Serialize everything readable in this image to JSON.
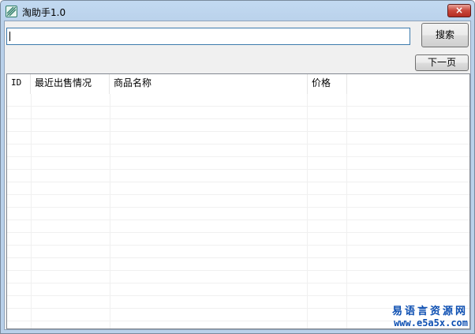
{
  "window": {
    "title": "淘助手1.0",
    "close_label": "×",
    "app_icon": "taobao-helper-app-icon",
    "accent": "#c8463a"
  },
  "search": {
    "value": "",
    "button_label": "搜索"
  },
  "pager": {
    "next_label": "下一页"
  },
  "table": {
    "columns": [
      "ID",
      "最近出售情况",
      "商品名称",
      "价格",
      ""
    ],
    "rows": []
  },
  "watermark": {
    "line1": "易语言资源网",
    "line2": "www.e5a5x.com",
    "color": "#0d4fb2"
  }
}
